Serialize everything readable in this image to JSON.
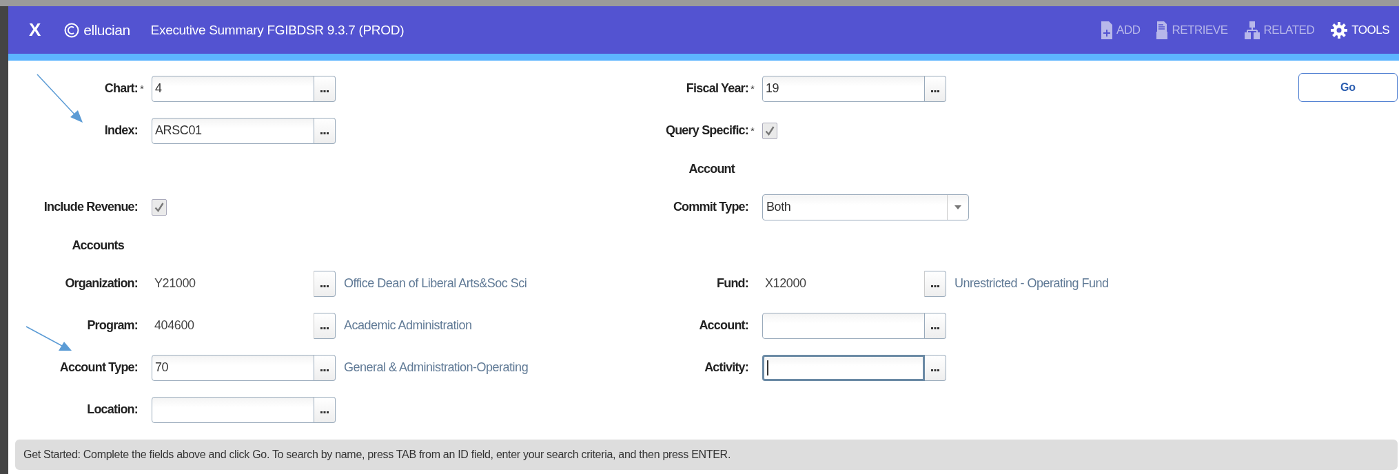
{
  "header": {
    "close": "X",
    "logo": "ellucian",
    "title": "Executive Summary FGIBDSR 9.3.7 (PROD)",
    "actions": [
      {
        "label": "ADD",
        "disabled": true
      },
      {
        "label": "RETRIEVE",
        "disabled": true
      },
      {
        "label": "RELATED",
        "disabled": true
      },
      {
        "label": "TOOLS",
        "disabled": false
      }
    ]
  },
  "go_button": "Go",
  "rows": [
    {
      "left": {
        "kind": "input",
        "label": "Chart:",
        "required_mark": "*",
        "value": "4",
        "focused": false
      },
      "right": {
        "kind": "input",
        "label": "Fiscal Year:",
        "required_mark": "*",
        "value": "19",
        "focused": false
      }
    },
    {
      "left": {
        "kind": "input",
        "label": "Index:",
        "value": "ARSC01",
        "focused": false
      },
      "right": {
        "kind": "checkbox",
        "label": "Query Specific:",
        "required_mark": "*",
        "checked": true
      }
    },
    {
      "right": {
        "kind": "note",
        "label": "Account"
      }
    },
    {
      "left": {
        "kind": "checkbox",
        "label": "Include Revenue:",
        "checked": true
      },
      "right": {
        "kind": "select",
        "label": "Commit Type:",
        "value": "Both"
      }
    },
    {
      "left": {
        "kind": "note",
        "label": "Accounts"
      }
    },
    {
      "left": {
        "kind": "display",
        "label": "Organization:",
        "value": "Y21000",
        "description": "Office Dean of Liberal Arts&Soc Sci"
      },
      "right": {
        "kind": "display",
        "label": "Fund:",
        "value": "X12000",
        "description": "Unrestricted - Operating Fund"
      }
    },
    {
      "left": {
        "kind": "display",
        "label": "Program:",
        "value": "404600",
        "description": "Academic Administration"
      },
      "right": {
        "kind": "input",
        "label": "Account:",
        "focused": false
      }
    },
    {
      "left": {
        "kind": "input",
        "label": "Account Type:",
        "value": "70",
        "description": "General & Administration-Operating",
        "focused": false
      },
      "right": {
        "kind": "input",
        "label": "Activity:",
        "focused": true
      }
    },
    {
      "left": {
        "kind": "input",
        "label": "Location:",
        "focused": false
      }
    }
  ],
  "status_bar": "Get Started: Complete the fields above and click Go. To search by name, press TAB from an ID field, enter your search criteria, and then press ENTER."
}
